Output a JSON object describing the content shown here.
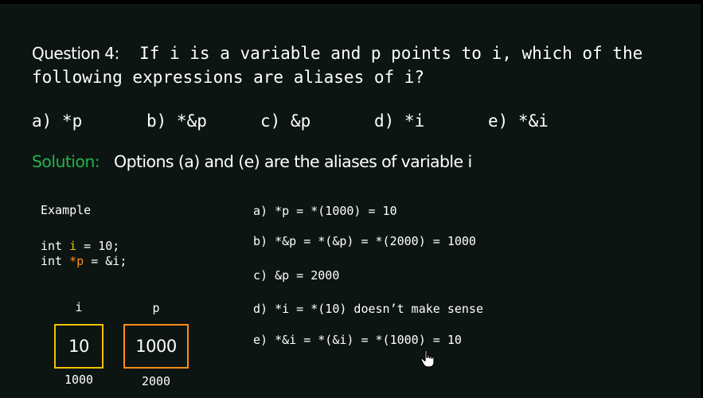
{
  "question": {
    "label": "Question 4:",
    "text": "If i is a variable and p points to i, which of the following expressions are aliases of i?"
  },
  "options": [
    "a) *p",
    "b) *&p",
    "c) &p",
    "d) *i",
    "e) *&i"
  ],
  "solution": {
    "label": "Solution:",
    "text": "Options (a) and (e) are the aliases of variable i"
  },
  "example": {
    "title": "Example",
    "line1": {
      "prefix": "int ",
      "var": "i",
      "suffix": " = 10;"
    },
    "line2": {
      "prefix": "int ",
      "var": "*p",
      "suffix": " = &i;"
    }
  },
  "diagram": {
    "i_label": "i",
    "p_label": "p",
    "i_value": "10",
    "p_value": "1000",
    "i_address": "1000",
    "p_address": "2000"
  },
  "evaluations": [
    "a) *p = *(1000) = 10",
    "b) *&p = *(&p) = *(2000) = 1000",
    "c) &p = 2000",
    "d) *i = *(10) doesn’t make sense",
    "e) *&i = *(&i) = *(1000) = 10"
  ],
  "colors": {
    "background": "#0d1512",
    "solution_label": "#22b14c",
    "var_i": "#f2c200",
    "var_p": "#ff8c1a"
  },
  "icons": {
    "cursor": "hand-pointer-icon"
  }
}
